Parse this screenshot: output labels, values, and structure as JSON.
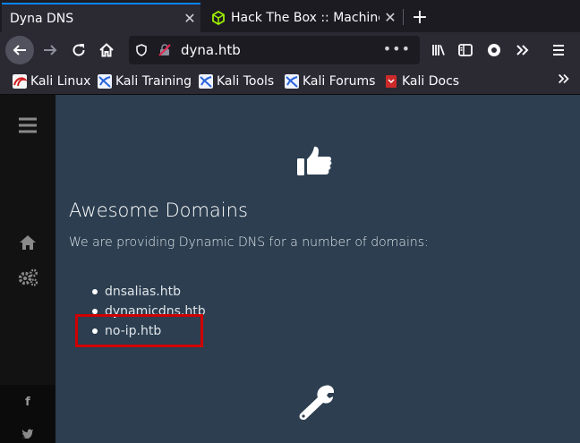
{
  "tabs": [
    {
      "title": "Dyna DNS",
      "active": true
    },
    {
      "title": "Hack The Box :: Machines",
      "active": false
    }
  ],
  "nav": {
    "url": "dyna.htb",
    "more": "•••"
  },
  "bookmarks": [
    {
      "label": "Kali Linux",
      "icon": "kali-linux-icon"
    },
    {
      "label": "Kali Training",
      "icon": "kali-dragon-icon"
    },
    {
      "label": "Kali Tools",
      "icon": "kali-dragon-icon"
    },
    {
      "label": "Kali Forums",
      "icon": "kali-dragon-icon"
    },
    {
      "label": "Kali Docs",
      "icon": "kali-docs-icon"
    }
  ],
  "sidebar": {
    "icons": [
      "hamburger-icon",
      "home-icon",
      "gears-icon",
      "facebook-icon",
      "twitter-icon"
    ],
    "facebook": "f"
  },
  "main": {
    "hero_icon": "thumbs-up-icon",
    "title": "Awesome Domains",
    "intro": "We are providing Dynamic DNS for a number of domains:",
    "domains": [
      "dnsalias.htb",
      "dynamicdns.htb",
      "no-ip.htb"
    ],
    "highlighted_domain": "no-ip.htb",
    "footer_icon": "wrench-icon"
  },
  "colors": {
    "page_bg": "#2c3e50",
    "sidebar_bg": "#121212",
    "highlight": "#d10000",
    "tab_accent": "#0a84ff"
  }
}
